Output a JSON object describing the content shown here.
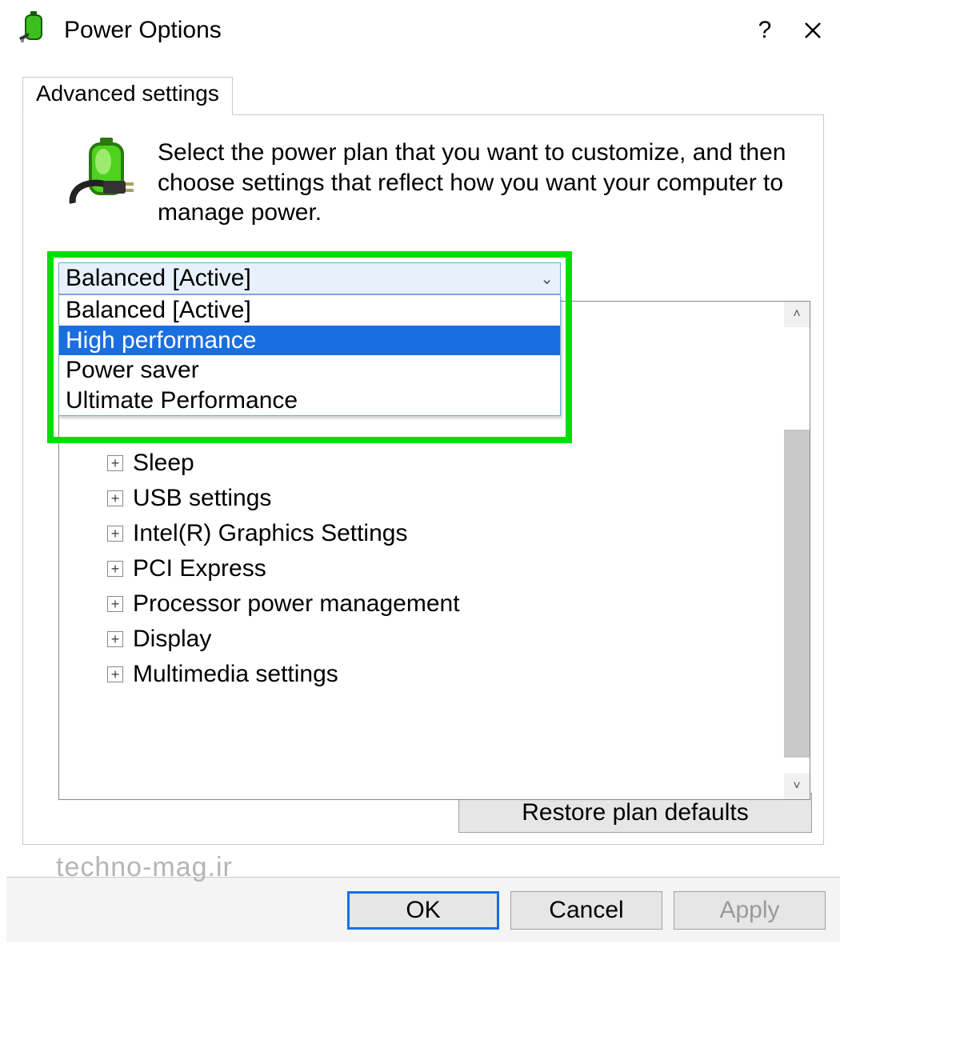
{
  "window": {
    "title": "Power Options",
    "tab": "Advanced settings",
    "description": "Select the power plan that you want to customize, and then choose settings that reflect how you want your computer to manage power."
  },
  "plan_combo": {
    "selected": "Balanced [Active]",
    "options": [
      "Balanced [Active]",
      "High performance",
      "Power saver",
      "Ultimate Performance"
    ],
    "highlighted_index": 1
  },
  "tree": [
    "Sleep",
    "USB settings",
    "Intel(R) Graphics Settings",
    "PCI Express",
    "Processor power management",
    "Display",
    "Multimedia settings"
  ],
  "buttons": {
    "restore": "Restore plan defaults",
    "ok": "OK",
    "cancel": "Cancel",
    "apply": "Apply"
  },
  "watermark": "techno-mag.ir"
}
